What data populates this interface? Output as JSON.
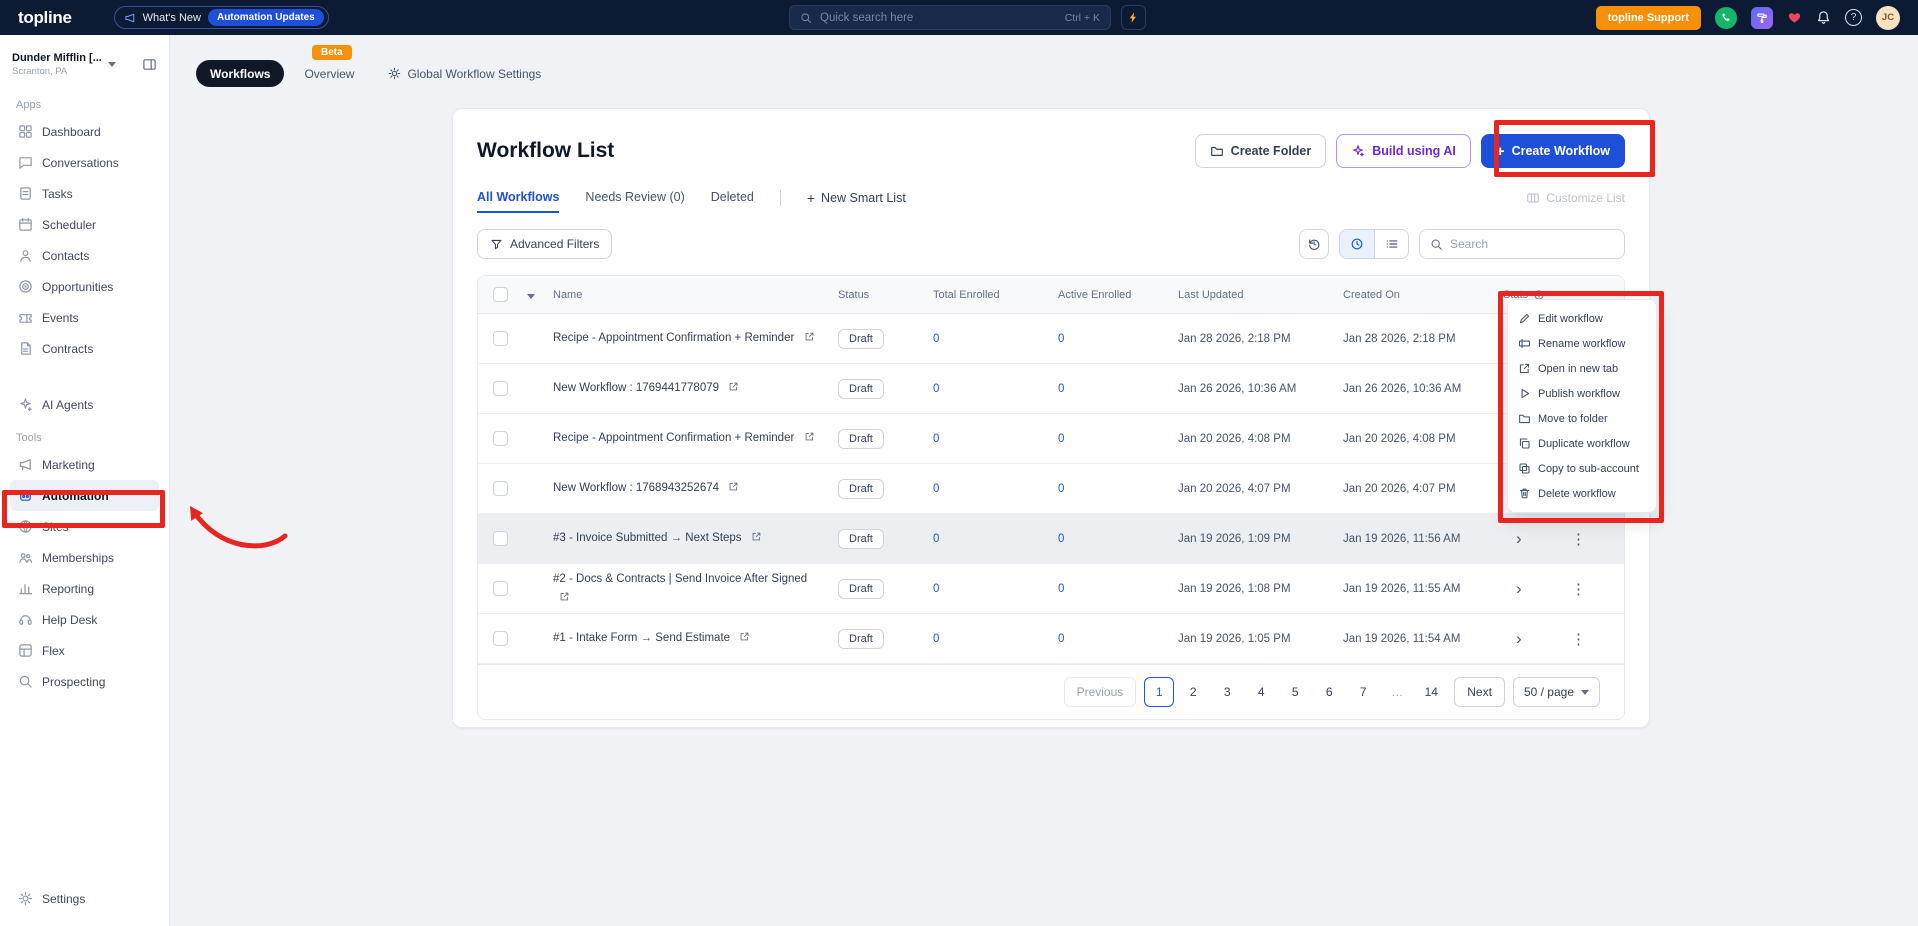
{
  "colors": {
    "topbar_bg": "#0d1a33",
    "accent_blue": "#1e4fd8",
    "link_blue": "#2155e0",
    "annotation_red": "#e8251f",
    "support_orange": "#f79009",
    "ai_purple": "#6d28d9",
    "dark_pill": "#101828",
    "success_green": "#12b76a"
  },
  "topbar": {
    "logo": "topline",
    "whats_new_label": "What's New",
    "whats_new_badge": "Automation Updates",
    "search_placeholder": "Quick search here",
    "search_shortcut": "Ctrl + K",
    "support_button": "topline Support",
    "avatar_initials": "JC"
  },
  "sidebar": {
    "account_name": "Dunder Mifflin [...",
    "account_location": "Scranton, PA",
    "apps_label": "Apps",
    "apps": [
      {
        "label": "Dashboard",
        "icon": "dashboard-icon"
      },
      {
        "label": "Conversations",
        "icon": "conversations-icon"
      },
      {
        "label": "Tasks",
        "icon": "tasks-icon"
      },
      {
        "label": "Scheduler",
        "icon": "scheduler-icon"
      },
      {
        "label": "Contacts",
        "icon": "contacts-icon"
      },
      {
        "label": "Opportunities",
        "icon": "opportunities-icon"
      },
      {
        "label": "Events",
        "icon": "events-icon"
      },
      {
        "label": "Contracts",
        "icon": "contracts-icon"
      }
    ],
    "ai_items": [
      {
        "label": "AI Agents",
        "icon": "ai-agents-icon"
      }
    ],
    "tools_label": "Tools",
    "tools": [
      {
        "label": "Marketing",
        "icon": "marketing-icon"
      },
      {
        "label": "Automation",
        "icon": "automation-icon",
        "active": true
      },
      {
        "label": "Sites",
        "icon": "sites-icon"
      },
      {
        "label": "Memberships",
        "icon": "memberships-icon"
      },
      {
        "label": "Reporting",
        "icon": "reporting-icon"
      },
      {
        "label": "Help Desk",
        "icon": "help-desk-icon"
      },
      {
        "label": "Flex",
        "icon": "flex-icon"
      },
      {
        "label": "Prospecting",
        "icon": "prospecting-icon"
      }
    ],
    "settings_label": "Settings"
  },
  "page_tabs": {
    "beta_badge": "Beta",
    "tabs": [
      {
        "label": "Workflows",
        "active": true
      },
      {
        "label": "Overview"
      },
      {
        "label": "Global Workflow Settings",
        "icon": "gear-icon"
      }
    ]
  },
  "header": {
    "title": "Workflow List",
    "create_folder_label": "Create Folder",
    "build_ai_label": "Build using AI",
    "create_workflow_label": "Create Workflow"
  },
  "list_tabs": {
    "tabs": [
      {
        "label": "All Workflows",
        "active": true
      },
      {
        "label": "Needs Review (0)"
      },
      {
        "label": "Deleted"
      }
    ],
    "new_smart_list_label": "New Smart List",
    "customize_list_label": "Customize List"
  },
  "filters": {
    "advanced_label": "Advanced Filters",
    "search_placeholder": "Search"
  },
  "table": {
    "columns": [
      "Name",
      "Status",
      "Total Enrolled",
      "Active Enrolled",
      "Last Updated",
      "Created On",
      "Stats"
    ],
    "rows": [
      {
        "name": "Recipe - Appointment Confirmation + Reminder",
        "status": "Draft",
        "total": "0",
        "active_enrolled": "0",
        "updated": "Jan 28 2026, 2:18 PM",
        "created": "Jan 28 2026, 2:18 PM"
      },
      {
        "name": "New Workflow : 1769441778079",
        "status": "Draft",
        "total": "0",
        "active_enrolled": "0",
        "updated": "Jan 26 2026, 10:36 AM",
        "created": "Jan 26 2026, 10:36 AM"
      },
      {
        "name": "Recipe - Appointment Confirmation + Reminder",
        "status": "Draft",
        "total": "0",
        "active_enrolled": "0",
        "updated": "Jan 20 2026, 4:08 PM",
        "created": "Jan 20 2026, 4:08 PM"
      },
      {
        "name": "New Workflow : 1768943252674",
        "status": "Draft",
        "total": "0",
        "active_enrolled": "0",
        "updated": "Jan 20 2026, 4:07 PM",
        "created": "Jan 20 2026, 4:07 PM"
      },
      {
        "name": "#3 - Invoice Submitted → Next Steps",
        "status": "Draft",
        "total": "0",
        "active_enrolled": "0",
        "updated": "Jan 19 2026, 1:09 PM",
        "created": "Jan 19 2026, 11:56 AM",
        "highlighted": true
      },
      {
        "name": "#2 - Docs & Contracts | Send Invoice After Signed",
        "status": "Draft",
        "total": "0",
        "active_enrolled": "0",
        "updated": "Jan 19 2026, 1:08 PM",
        "created": "Jan 19 2026, 11:55 AM"
      },
      {
        "name": "#1 - Intake Form → Send Estimate",
        "status": "Draft",
        "total": "0",
        "active_enrolled": "0",
        "updated": "Jan 19 2026, 1:05 PM",
        "created": "Jan 19 2026, 11:54 AM"
      }
    ]
  },
  "context_menu": {
    "items": [
      {
        "label": "Edit workflow",
        "icon": "edit-icon"
      },
      {
        "label": "Rename workflow",
        "icon": "rename-icon"
      },
      {
        "label": "Open in new tab",
        "icon": "open-new-tab-icon"
      },
      {
        "label": "Publish workflow",
        "icon": "publish-icon"
      },
      {
        "label": "Move to folder",
        "icon": "folder-icon"
      },
      {
        "label": "Duplicate workflow",
        "icon": "duplicate-icon"
      },
      {
        "label": "Copy to sub-account",
        "icon": "copy-icon"
      },
      {
        "label": "Delete workflow",
        "icon": "delete-icon"
      }
    ]
  },
  "pagination": {
    "previous": "Previous",
    "pages": [
      {
        "label": "1",
        "active": true
      },
      {
        "label": "2"
      },
      {
        "label": "3"
      },
      {
        "label": "4"
      },
      {
        "label": "5"
      },
      {
        "label": "6"
      },
      {
        "label": "7"
      },
      {
        "label": "…",
        "ellipsis": true
      },
      {
        "label": "14"
      }
    ],
    "next": "Next",
    "page_size": "50 / page"
  }
}
